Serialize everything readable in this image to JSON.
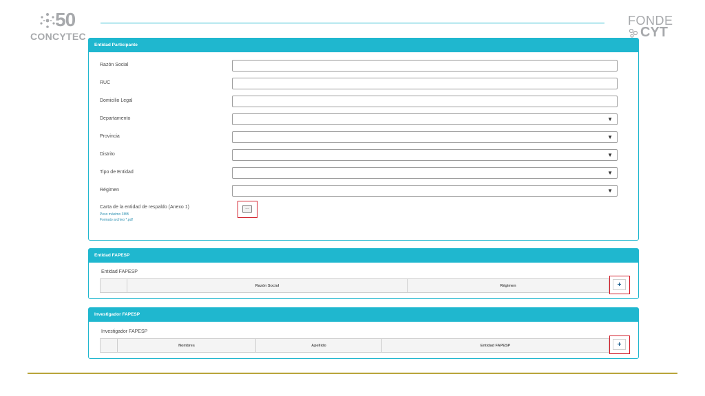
{
  "header": {
    "logo_left_number": "50",
    "logo_left_text": "CONCYTEC",
    "logo_right_line1": "FONDE",
    "logo_right_line2": "CYT"
  },
  "entidad_participante": {
    "title": "Entidad Participante",
    "fields": [
      {
        "label": "Razón Social",
        "type": "text",
        "value": ""
      },
      {
        "label": "RUC",
        "type": "text",
        "value": ""
      },
      {
        "label": "Domicilio Legal",
        "type": "text",
        "value": ""
      },
      {
        "label": "Departamento",
        "type": "select",
        "value": ""
      },
      {
        "label": "Provincia",
        "type": "select",
        "value": ""
      },
      {
        "label": "Distrito",
        "type": "select",
        "value": ""
      },
      {
        "label": "Tipo de Entidad",
        "type": "select",
        "value": ""
      },
      {
        "label": "Régimen",
        "type": "select",
        "value": ""
      }
    ],
    "file": {
      "label": "Carta de la entidad de respaldo (Anexo 1)",
      "hint1": "Peso máximo 3MB",
      "hint2": "Formato archivo *.pdf",
      "button": "..."
    }
  },
  "entidad_fapesp": {
    "title": "Entidad FAPESP",
    "sub_label": "Entidad FAPESP",
    "columns": [
      "",
      "Razón Social",
      "Régimen"
    ],
    "add_button": "+"
  },
  "investigador_fapesp": {
    "title": "Investigador FAPESP",
    "sub_label": "Investigador FAPESP",
    "columns": [
      "",
      "Nombres",
      "Apellido",
      "Entidad FAPESP"
    ],
    "add_button": "+"
  },
  "colors": {
    "accent": "#1fb7cf",
    "highlight": "#d21f2b",
    "footer_rule": "#b8a43a"
  }
}
